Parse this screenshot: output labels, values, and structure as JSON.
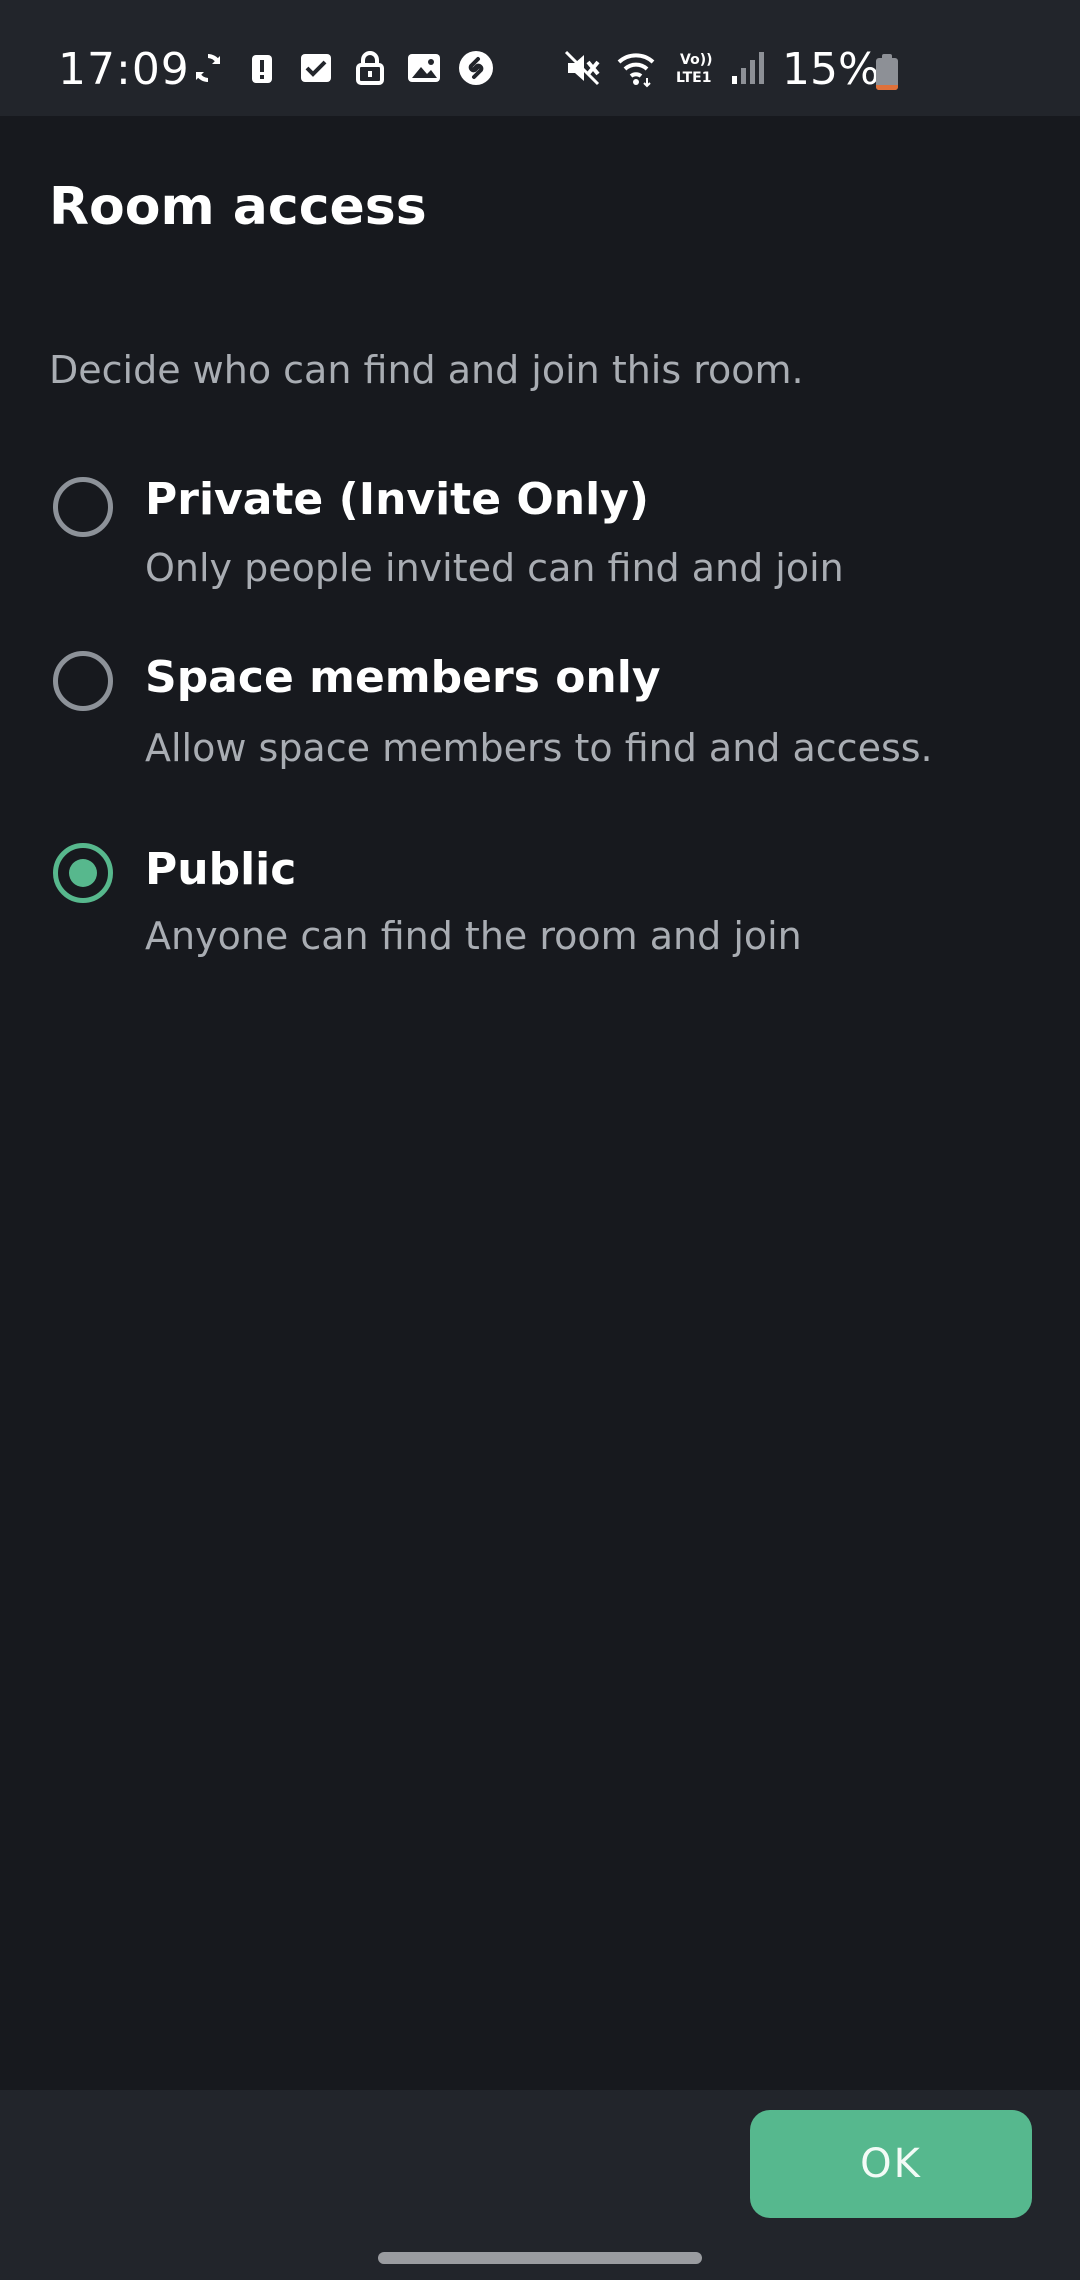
{
  "status_bar": {
    "time": "17:09",
    "battery_percent": "15%",
    "battery_level": 0.15,
    "icons": [
      "sync-icon",
      "alert-icon",
      "checkbox-icon",
      "lock-icon",
      "image-icon",
      "shazam-icon",
      "mute-icon",
      "wifi-icon",
      "volte-icon",
      "signal-icon",
      "battery-icon"
    ],
    "volte_text": "Vo)) LTE1"
  },
  "dialog": {
    "title": "Room access",
    "description": "Decide who can find and join this room.",
    "options": [
      {
        "label": "Private (Invite Only)",
        "subtitle": "Only people invited can find and join",
        "selected": false
      },
      {
        "label": "Space members only",
        "subtitle": "Allow space members to find and access.",
        "selected": false
      },
      {
        "label": "Public",
        "subtitle": "Anyone can find the room and join",
        "selected": true
      }
    ],
    "ok_label": "OK"
  },
  "colors": {
    "background": "#17191e",
    "bar_background": "#22252b",
    "accent": "#57b88d",
    "text_primary": "#ffffff",
    "text_secondary": "#a9adb3",
    "battery_low": "#e0713a"
  }
}
